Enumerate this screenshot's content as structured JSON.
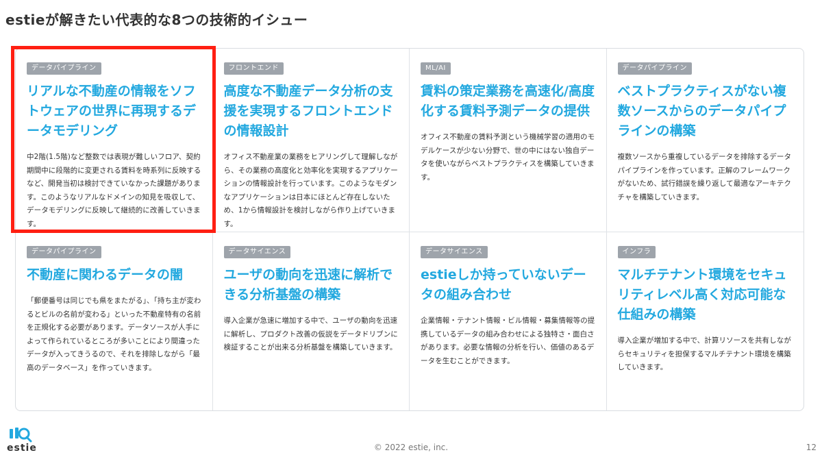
{
  "slide": {
    "title": "estieが解きたい代表的な8つの技術的イシュー",
    "copyright": "© 2022 estie, inc.",
    "page_number": "12",
    "logo_text": "estie",
    "highlight_color": "#ff1f12",
    "accent_color": "#22a8df"
  },
  "cards": [
    {
      "tag": "データパイプライン",
      "title": "リアルな不動産の情報をソフトウェアの世界に再現するデータモデリング",
      "body": "中2階(1.5階)など整数では表現が難しいフロア、契約期間中に段階的に変更される賃料を時系列に反映するなど、開発当初は検討できていなかった課題があります。このようなリアルなドメインの知見を吸収して、データモデリングに反映して継続的に改善していきます。"
    },
    {
      "tag": "フロントエンド",
      "title": "高度な不動産データ分析の支援を実現するフロントエンドの情報設計",
      "body": "オフィス不動産業の業務をヒアリングして理解しながら、その業務の高度化と効率化を実現するアプリケーションの情報設計を行っています。このようなモダンなアプリケーションは日本にほとんど存在しないため、1から情報設計を検討しながら作り上げていきます。"
    },
    {
      "tag": "ML/AI",
      "title": "賃料の策定業務を高速化/高度化する賃料予測データの提供",
      "body": "オフィス不動産の賃料予測という機械学習の適用のモデルケースが少ない分野で、世の中にはない独自データを使いながらベストプラクティスを構築していきます。"
    },
    {
      "tag": "データパイプライン",
      "title": "ベストプラクティスがない複数ソースからのデータパイプラインの構築",
      "body": "複数ソースから重複しているデータを排除するデータパイプラインを作っています。正解のフレームワークがないため、試行錯誤を繰り返して最適なアーキテクチャを構築していきます。"
    },
    {
      "tag": "データパイプライン",
      "title": "不動産に関わるデータの闇",
      "body": "「郵便番号は同じでも県をまたがる」、「持ち主が変わるとビルの名前が変わる」といった不動産特有の名前を正規化する必要があります。データソースが人手によって作られているところが多いことにより間違ったデータが入ってきうるので、それを排除しながら「最高のデータベース」を作っていきます。"
    },
    {
      "tag": "データサイエンス",
      "title": "ユーザの動向を迅速に解析できる分析基盤の構築",
      "body": "導入企業が急速に増加する中で、ユーザの動向を迅速に解析し、プロダクト改善の仮説をデータドリブンに検証することが出来る分析基盤を構築していきます。"
    },
    {
      "tag": "データサイエンス",
      "title": "estieしか持っていないデータの組み合わせ",
      "body": "企業情報・テナント情報・ビル情報・募集情報等の提携しているデータの組み合わせによる独特さ・面白さがあります。必要な情報の分析を行い、価値のあるデータを生むことができます。"
    },
    {
      "tag": "インフラ",
      "title": "マルチテナント環境をセキュリティレベル高く対応可能な仕組みの構築",
      "body": "導入企業が増加する中で、計算リソースを共有しながらセキュリティを担保するマルチテナント環境を構築していきます。"
    }
  ]
}
